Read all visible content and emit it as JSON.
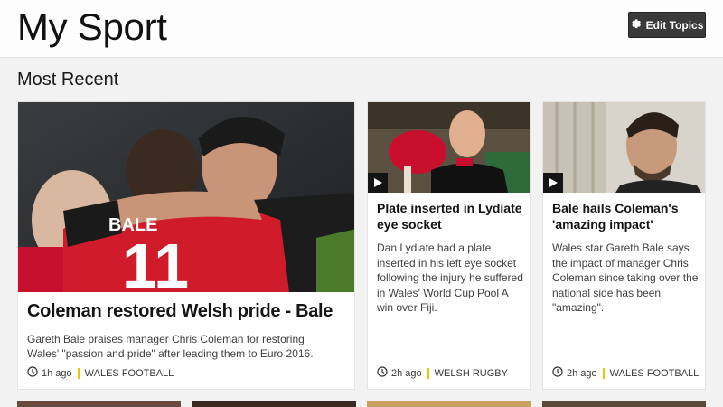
{
  "header": {
    "title": "My Sport",
    "edit_button_label": "Edit Topics",
    "edit_icon": "gear-icon"
  },
  "section": {
    "title": "Most Recent"
  },
  "cards": [
    {
      "headline": "Coleman restored Welsh pride - Bale",
      "summary": "Gareth Bale praises manager Chris Coleman for restoring Wales' \"passion and pride\" after leading them to Euro 2016.",
      "time": "1h ago",
      "topic": "WALES FOOTBALL",
      "has_video": false,
      "image_icon": "football-celebration-photo"
    },
    {
      "headline": "Plate inserted in Lydiate eye socket",
      "summary": "Dan Lydiate had a plate inserted in his left eye socket following the injury he suffered in Wales' World Cup Pool A win over Fiji.",
      "time": "2h ago",
      "topic": "WELSH RUGBY",
      "has_video": true,
      "image_icon": "rugby-player-photo"
    },
    {
      "headline": "Bale hails Coleman's 'amazing impact'",
      "summary": "Wales star Gareth Bale says the impact of manager Chris Coleman since taking over the national side has been \"amazing\".",
      "time": "2h ago",
      "topic": "WALES FOOTBALL",
      "has_video": true,
      "image_icon": "player-interview-photo"
    }
  ],
  "colors": {
    "topic_separator": "#f0c400",
    "button_bg": "#3a3a3a"
  }
}
